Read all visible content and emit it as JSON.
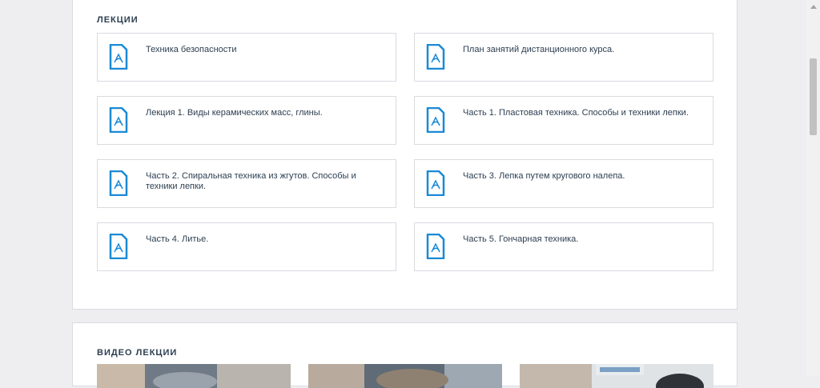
{
  "lectures": {
    "title": "ЛЕКЦИИ",
    "items": [
      {
        "label": "Техника безопасности",
        "icon": "pdf-icon"
      },
      {
        "label": "План занятий дистанционного курса.",
        "icon": "pdf-icon"
      },
      {
        "label": "Лекция 1. Виды керамических масс, глины.",
        "icon": "pdf-icon"
      },
      {
        "label": "Часть 1. Пластовая техника. Способы и техники лепки.",
        "icon": "pdf-icon"
      },
      {
        "label": "Часть 2. Спиральная техника из жгутов. Способы и техники лепки.",
        "icon": "pdf-icon"
      },
      {
        "label": "Часть 3. Лепка путем кругового налепа.",
        "icon": "pdf-icon"
      },
      {
        "label": "Часть 4. Литье.",
        "icon": "pdf-icon"
      },
      {
        "label": "Часть 5. Гончарная техника.",
        "icon": "pdf-icon"
      }
    ]
  },
  "videos": {
    "title": "ВИДЕО ЛЕКЦИИ"
  },
  "colors": {
    "accent": "#1a8ad6",
    "text": "#2c3e50",
    "border": "#dadbe0",
    "background": "#eeeef1"
  }
}
